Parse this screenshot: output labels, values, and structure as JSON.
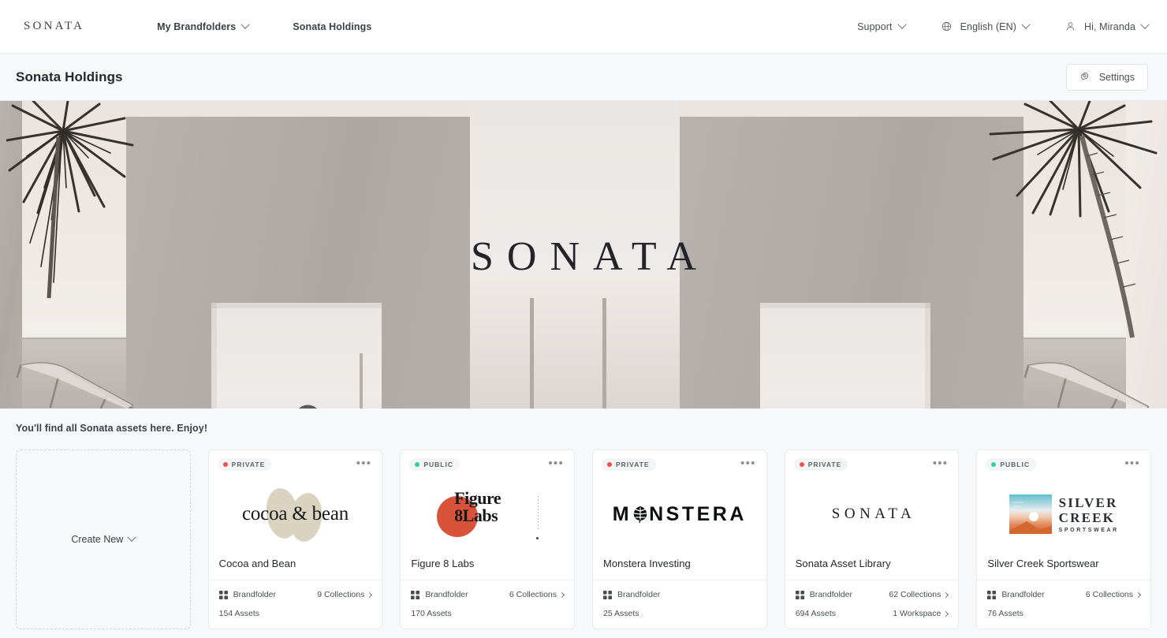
{
  "topnav": {
    "brand": "SONATA",
    "left_items": [
      {
        "label": "My Brandfolders",
        "has_caret": true
      },
      {
        "label": "Sonata Holdings",
        "has_caret": false
      }
    ],
    "right_items": [
      {
        "label": "Support",
        "icon": "",
        "has_caret": true
      },
      {
        "label": "English (EN)",
        "icon": "globe-icon",
        "has_caret": true
      },
      {
        "label": "Hi, Miranda",
        "icon": "user-icon",
        "has_caret": true
      }
    ]
  },
  "titlebar": {
    "title": "Sonata Holdings",
    "settings_label": "Settings"
  },
  "hero": {
    "wordmark": "SONATA"
  },
  "description": "You'll find all Sonata assets here. Enjoy!",
  "create_card": {
    "label": "Create New"
  },
  "colors": {
    "private_dot": "#f0514b",
    "public_dot": "#33cfa0",
    "badge_bg": "#f3f4f6",
    "page_bg": "#f7f8fa",
    "card_bg": "#ffffff",
    "accent_red": "#d9533b",
    "cocoa_bean": "#d9d3bf"
  },
  "cards": [
    {
      "visibility": "PRIVATE",
      "visibility_type": "private",
      "name": "Cocoa and Bean",
      "logo": "cocoa-and-bean-logo",
      "logo_text": "cocoa & bean",
      "type_label": "Brandfolder",
      "collections": "9 Collections",
      "assets": "154 Assets",
      "workspace": ""
    },
    {
      "visibility": "PUBLIC",
      "visibility_type": "public",
      "name": "Figure 8 Labs",
      "logo": "figure-8-labs-logo",
      "logo_line1": "Figure",
      "logo_line2": "8Labs",
      "type_label": "Brandfolder",
      "collections": "6 Collections",
      "assets": "170 Assets",
      "workspace": ""
    },
    {
      "visibility": "PRIVATE",
      "visibility_type": "private",
      "name": "Monstera Investing",
      "logo": "monstera-logo",
      "logo_pre": "M",
      "logo_post": "NSTERA",
      "type_label": "Brandfolder",
      "collections": "",
      "assets": "25 Assets",
      "workspace": ""
    },
    {
      "visibility": "PRIVATE",
      "visibility_type": "private",
      "name": "Sonata Asset Library",
      "logo": "sonata-logo",
      "logo_text": "SONATA",
      "type_label": "Brandfolder",
      "collections": "62 Collections",
      "assets": "694 Assets",
      "workspace": "1 Workspace"
    },
    {
      "visibility": "PUBLIC",
      "visibility_type": "public",
      "name": "Silver Creek Sportswear",
      "logo": "silver-creek-logo",
      "logo_line1": "SILVER",
      "logo_line2": "CREEK",
      "logo_sub": "SPORTSWEAR",
      "type_label": "Brandfolder",
      "collections": "6 Collections",
      "assets": "76 Assets",
      "workspace": ""
    }
  ],
  "icons": {
    "dots": "•••",
    "gear": "gear-icon",
    "grid": "grid-icon"
  }
}
